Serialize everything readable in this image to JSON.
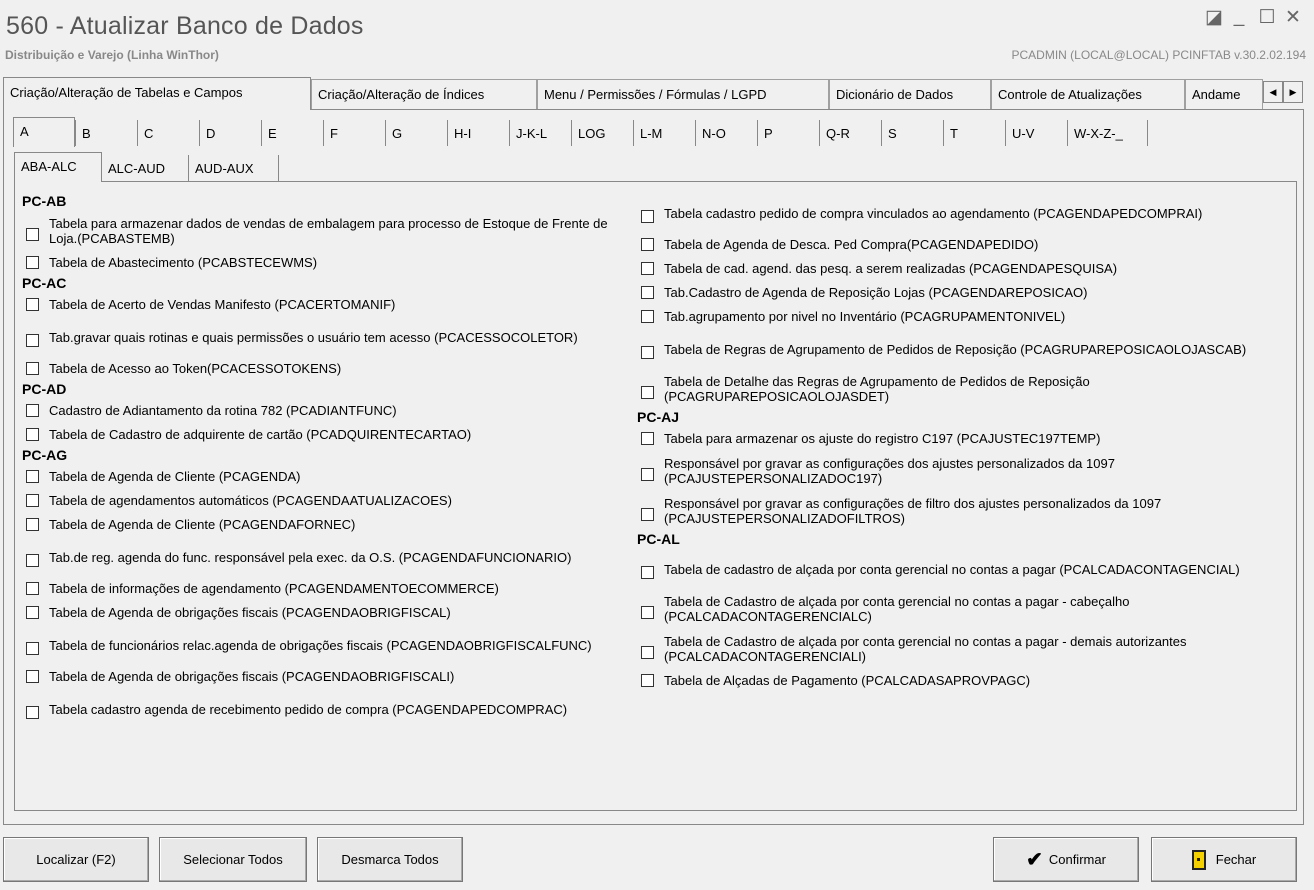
{
  "window": {
    "title": "560 - Atualizar Banco de Dados",
    "subtitle": "Distribuição e Varejo (Linha WinThor)",
    "info": "PCADMIN (LOCAL@LOCAL)  PCINFTAB  v.30.2.02.194",
    "controls": [
      "◪",
      "_",
      "☐",
      "✕"
    ]
  },
  "main_tabs": [
    "Criação/Alteração de Tabelas e Campos",
    "Criação/Alteração de Índices",
    "Menu / Permissões / Fórmulas / LGPD",
    "Dicionário de Dados",
    "Controle de Atualizações",
    "Andame"
  ],
  "scroll_glyphs": [
    "◀",
    "▶"
  ],
  "letter_tabs": [
    "A",
    "B",
    "C",
    "D",
    "E",
    "F",
    "G",
    "H-I",
    "J-K-L",
    "LOG",
    "L-M",
    "N-O",
    "P",
    "Q-R",
    "S",
    "T",
    "U-V",
    "W-X-Z-_"
  ],
  "sub_tabs": [
    "ABA-ALC",
    "ALC-AUD",
    "AUD-AUX"
  ],
  "left_column": [
    {
      "title": "PC-AB"
    },
    {
      "text": "Tabela para armazenar dados de vendas de embalagem para processo de Estoque de Frente de Loja.(PCABASTEMB)",
      "lines": 2
    },
    {
      "text": "Tabela de Abastecimento (PCABSTECEWMS)",
      "lines": 1
    },
    {
      "title": "PC-AC"
    },
    {
      "text": "Tabela de Acerto de Vendas Manifesto (PCACERTOMANIF)",
      "lines": 1
    },
    {
      "text": "Tab.gravar quais rotinas e quais permissões o usuário tem acesso (PCACESSOCOLETOR)",
      "lines": 2
    },
    {
      "text": "Tabela de Acesso ao Token(PCACESSOTOKENS)",
      "lines": 1
    },
    {
      "title": "PC-AD"
    },
    {
      "text": "Cadastro de Adiantamento da rotina 782 (PCADIANTFUNC)",
      "lines": 1
    },
    {
      "text": "Tabela de Cadastro de adquirente de cartão (PCADQUIRENTECARTAO)",
      "lines": 1
    },
    {
      "title": "PC-AG"
    },
    {
      "text": "Tabela  de Agenda de Cliente (PCAGENDA)",
      "lines": 1
    },
    {
      "text": "Tabela de agendamentos automáticos (PCAGENDAATUALIZACOES)",
      "lines": 1
    },
    {
      "text": "Tabela  de Agenda de Cliente (PCAGENDAFORNEC)",
      "lines": 1
    },
    {
      "text": "Tab.de reg. agenda do func. responsável pela exec. da O.S. (PCAGENDAFUNCIONARIO)",
      "lines": 2
    },
    {
      "text": "Tabela de informações de agendamento (PCAGENDAMENTOECOMMERCE)",
      "lines": 1
    },
    {
      "text": "Tabela de Agenda de obrigações fiscais (PCAGENDAOBRIGFISCAL)",
      "lines": 1
    },
    {
      "text": "Tabela de funcionários relac.agenda de obrigações fiscais (PCAGENDAOBRIGFISCALFUNC)",
      "lines": 2
    },
    {
      "text": "Tabela de Agenda de obrigações fiscais (PCAGENDAOBRIGFISCALI)",
      "lines": 1
    },
    {
      "text": "Tabela cadastro agenda de recebimento pedido de compra (PCAGENDAPEDCOMPRAC)",
      "lines": 2
    }
  ],
  "right_column": [
    {
      "text": "Tabela cadastro pedido de compra vinculados ao agendamento (PCAGENDAPEDCOMPRAI)",
      "lines": 2
    },
    {
      "text": "Tabela  de Agenda de Desca. Ped Compra(PCAGENDAPEDIDO)",
      "lines": 1
    },
    {
      "text": "Tabela de cad. agend. das pesq. a serem realizadas (PCAGENDAPESQUISA)",
      "lines": 1
    },
    {
      "text": "Tab.Cadastro de Agenda de Reposição Lojas (PCAGENDAREPOSICAO)",
      "lines": 1
    },
    {
      "text": "Tab.agrupamento por nivel no Inventário (PCAGRUPAMENTONIVEL)",
      "lines": 1
    },
    {
      "text": "Tabela de Regras de Agrupamento de Pedidos de Reposição (PCAGRUPAREPOSICAOLOJASCAB)",
      "lines": 2
    },
    {
      "text": "Tabela de Detalhe das Regras de Agrupamento de Pedidos de Reposição (PCAGRUPAREPOSICAOLOJASDET)",
      "lines": 2
    },
    {
      "title": "PC-AJ"
    },
    {
      "text": "Tabela para armazenar os ajuste do registro C197 (PCAJUSTEC197TEMP)",
      "lines": 1
    },
    {
      "text": "Responsável por gravar as configurações dos ajustes personalizados da 1097 (PCAJUSTEPERSONALIZADOC197)",
      "lines": 2
    },
    {
      "text": "Responsável por gravar as configurações de filtro dos ajustes personalizados da 1097 (PCAJUSTEPERSONALIZADOFILTROS)",
      "lines": 2
    },
    {
      "title": "PC-AL"
    },
    {
      "text": "Tabela de cadastro de alçada por conta gerencial no contas a pagar (PCALCADACONTAGENCIAL)",
      "lines": 2
    },
    {
      "text": "Tabela de Cadastro de alçada por conta gerencial no contas a pagar - cabeçalho (PCALCADACONTAGERENCIALC)",
      "lines": 2
    },
    {
      "text": "Tabela de Cadastro de alçada por conta gerencial no contas a pagar - demais autorizantes (PCALCADACONTAGERENCIALI)",
      "lines": 2
    },
    {
      "text": "Tabela de Alçadas de Pagamento (PCALCADASAPROVPAGC)",
      "lines": 1
    }
  ],
  "buttons": {
    "localizar": "Localizar (F2)",
    "selecionar": "Selecionar Todos",
    "desmarca": "Desmarca Todos",
    "confirmar": "Confirmar",
    "fechar": "Fechar",
    "check_glyph": "✔"
  }
}
